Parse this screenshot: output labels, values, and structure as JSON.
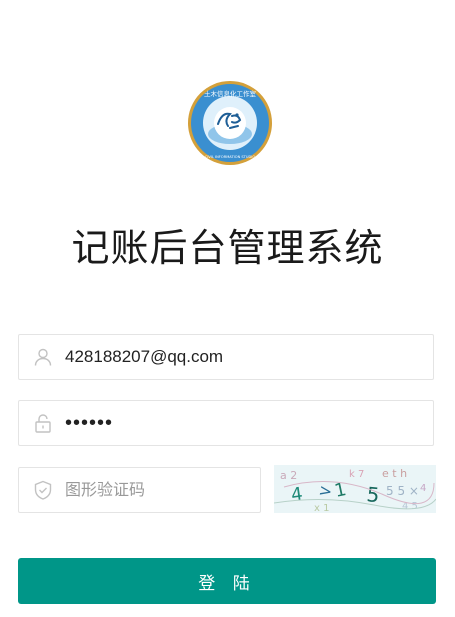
{
  "logo": {
    "ring_text": "土木信息化工作室",
    "subtext": "CIVIL INFORMATION STUDIO",
    "mark": "土木"
  },
  "title": "记账后台管理系统",
  "form": {
    "username": {
      "value": "428188207@qq.com",
      "placeholder": "",
      "icon": "user-icon"
    },
    "password": {
      "value": "••••••",
      "icon": "lock-icon"
    },
    "captcha": {
      "value": "",
      "placeholder": "图形验证码",
      "icon": "shield-icon"
    },
    "captcha_image": {
      "characters": "4>1 5",
      "icon": "captcha-image"
    },
    "submit_label": "登 陆"
  },
  "colors": {
    "primary": "#009688",
    "border": "#e4e4e4",
    "logo_blue": "#3a8fd0",
    "logo_gold": "#d4a03a"
  }
}
